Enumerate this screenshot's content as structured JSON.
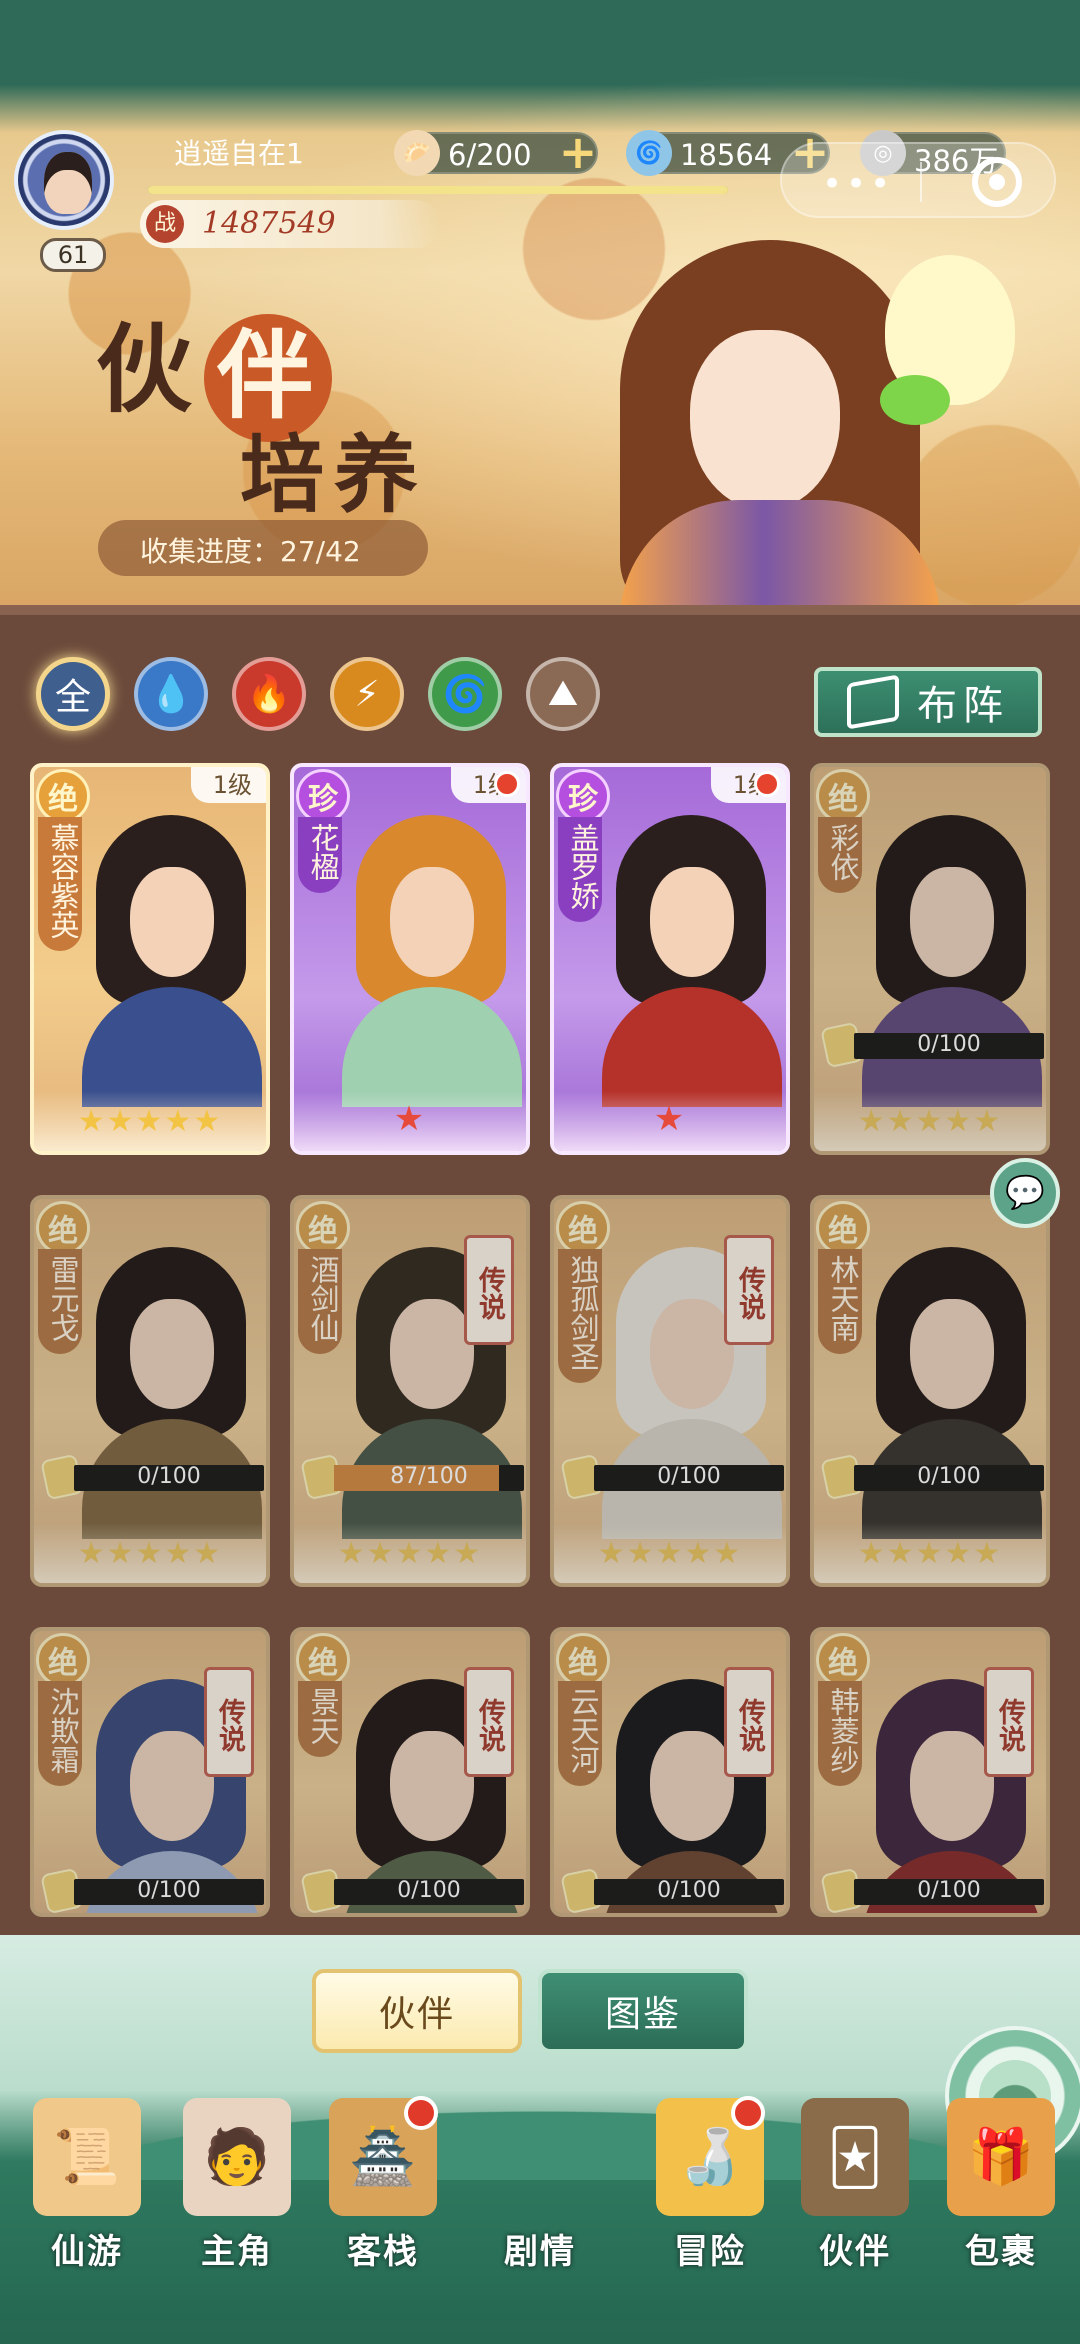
{
  "player": {
    "name": "逍遥自在1",
    "level": "61",
    "power_icon": "战",
    "power": "1487549",
    "exp_progress": 1.0
  },
  "resources": [
    {
      "name": "stamina",
      "icon": "bun-icon",
      "value": "6/200",
      "has_plus": true
    },
    {
      "name": "gold",
      "icon": "coin-swirl-icon",
      "value": "18564",
      "has_plus": true
    },
    {
      "name": "copper",
      "icon": "copper-coin-icon",
      "value": "386万",
      "has_plus": false
    }
  ],
  "capsule": {
    "dots": "•••"
  },
  "banner": {
    "title_left": "伙",
    "title_accent": "伴",
    "subtitle": "培养",
    "collection": "收集进度：27/42"
  },
  "filters": [
    {
      "label": "全",
      "element": "all",
      "color": "#3f5f8f",
      "active": true
    },
    {
      "label": "💧",
      "element": "water",
      "color": "#3a78c8",
      "active": false
    },
    {
      "label": "🔥",
      "element": "fire",
      "color": "#c93a2c",
      "active": false
    },
    {
      "label": "⚡",
      "element": "thunder",
      "color": "#d98a1e",
      "active": false
    },
    {
      "label": "🌀",
      "element": "wind",
      "color": "#3f9a4a",
      "active": false
    },
    {
      "label": "⛰",
      "element": "earth",
      "color": "#8a6a55",
      "active": false
    }
  ],
  "formation_button": "布阵",
  "partners": [
    {
      "name": "慕容紫英",
      "rarity": "绝",
      "tier": "gold",
      "owned": true,
      "level": "1级",
      "stars": "★★★★★",
      "red_dot": false,
      "legend": ""
    },
    {
      "name": "花楹",
      "rarity": "珍",
      "tier": "purple",
      "owned": true,
      "level": "1级",
      "stars": "★",
      "red_dot": true,
      "legend": ""
    },
    {
      "name": "盖罗娇",
      "rarity": "珍",
      "tier": "purple",
      "owned": true,
      "level": "1级",
      "stars": "★",
      "red_dot": true,
      "legend": ""
    },
    {
      "name": "彩依",
      "rarity": "绝",
      "tier": "gold",
      "owned": false,
      "fragments": "0/100",
      "fragment_progress": 0.0,
      "stars": "★★★★★",
      "legend": ""
    },
    {
      "name": "雷元戈",
      "rarity": "绝",
      "tier": "gold",
      "owned": false,
      "fragments": "0/100",
      "fragment_progress": 0.0,
      "stars": "★★★★★",
      "legend": ""
    },
    {
      "name": "酒剑仙",
      "rarity": "绝",
      "tier": "gold",
      "owned": false,
      "fragments": "87/100",
      "fragment_progress": 0.87,
      "stars": "★★★★★",
      "legend": "传说"
    },
    {
      "name": "独孤剑圣",
      "rarity": "绝",
      "tier": "gold",
      "owned": false,
      "fragments": "0/100",
      "fragment_progress": 0.0,
      "stars": "★★★★★",
      "legend": "传说"
    },
    {
      "name": "林天南",
      "rarity": "绝",
      "tier": "gold",
      "owned": false,
      "fragments": "0/100",
      "fragment_progress": 0.0,
      "stars": "★★★★★",
      "legend": ""
    },
    {
      "name": "沈欺霜",
      "rarity": "绝",
      "tier": "gold",
      "owned": false,
      "fragments": "0/100",
      "fragment_progress": 0.0,
      "stars": "",
      "legend": "传说"
    },
    {
      "name": "景天",
      "rarity": "绝",
      "tier": "gold",
      "owned": false,
      "fragments": "0/100",
      "fragment_progress": 0.0,
      "stars": "",
      "legend": "传说"
    },
    {
      "name": "云天河",
      "rarity": "绝",
      "tier": "gold",
      "owned": false,
      "fragments": "0/100",
      "fragment_progress": 0.0,
      "stars": "",
      "legend": "传说"
    },
    {
      "name": "韩菱纱",
      "rarity": "绝",
      "tier": "gold",
      "owned": false,
      "fragments": "0/100",
      "fragment_progress": 0.0,
      "stars": "",
      "legend": "传说"
    }
  ],
  "tabs": [
    {
      "label": "伙伴",
      "active": true
    },
    {
      "label": "图鉴",
      "active": false
    }
  ],
  "nav": [
    {
      "label": "仙游",
      "icon": "scroll-book-icon",
      "glyph": "📜",
      "red_dot": false
    },
    {
      "label": "主角",
      "icon": "hero-portrait-icon",
      "glyph": "🧑",
      "red_dot": false
    },
    {
      "label": "客栈",
      "icon": "inn-icon",
      "glyph": "🏯",
      "red_dot": true
    },
    {
      "label": "剧情",
      "icon": "story-landscape-icon",
      "glyph": "",
      "red_dot": false,
      "center": true
    },
    {
      "label": "冒险",
      "icon": "gourd-icon",
      "glyph": "🍶",
      "red_dot": true
    },
    {
      "label": "伙伴",
      "icon": "partner-cards-icon",
      "glyph": "🃏",
      "red_dot": false
    },
    {
      "label": "包裹",
      "icon": "gift-bag-icon",
      "glyph": "🎁",
      "red_dot": false
    }
  ],
  "colors": {
    "header_green": "#2f6a58",
    "panel_brown": "#6b4a3b",
    "accent_orange": "#c95a28",
    "notification_red": "#e5432e"
  }
}
